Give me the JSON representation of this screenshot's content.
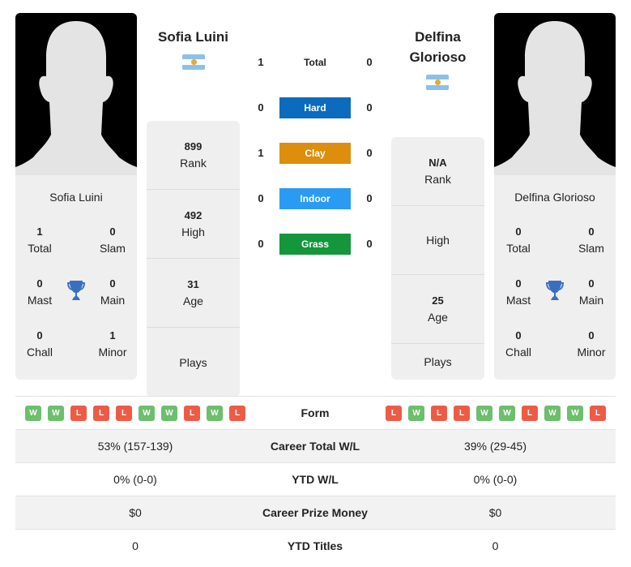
{
  "colors": {
    "hard": "#0a6bbf",
    "clay": "#dc8e0c",
    "indoor": "#2a9bf2",
    "grass": "#13973a",
    "win": "#6cbf6c",
    "loss": "#ee5b45",
    "trophy": "#3a6fbf"
  },
  "player1": {
    "name": "Sofia Luini",
    "card_name": "Sofia Luini",
    "flag": "argentina-flag",
    "rank": {
      "value": "899",
      "label": "Rank"
    },
    "high": {
      "value": "492",
      "label": "High"
    },
    "age": {
      "value": "31",
      "label": "Age"
    },
    "plays": {
      "value": "",
      "label": "Plays"
    },
    "titles": {
      "total": {
        "value": "1",
        "label": "Total"
      },
      "slam": {
        "value": "0",
        "label": "Slam"
      },
      "mast": {
        "value": "0",
        "label": "Mast"
      },
      "main": {
        "value": "0",
        "label": "Main"
      },
      "chall": {
        "value": "0",
        "label": "Chall"
      },
      "minor": {
        "value": "1",
        "label": "Minor"
      }
    },
    "form": [
      "W",
      "W",
      "L",
      "L",
      "L",
      "W",
      "W",
      "L",
      "W",
      "L"
    ]
  },
  "player2": {
    "name_line1": "Delfina",
    "name_line2": "Glorioso",
    "card_name": "Delfina Glorioso",
    "flag": "argentina-flag",
    "rank": {
      "value": "N/A",
      "label": "Rank"
    },
    "high": {
      "value": "",
      "label": "High"
    },
    "age": {
      "value": "25",
      "label": "Age"
    },
    "plays": {
      "value": "",
      "label": "Plays"
    },
    "titles": {
      "total": {
        "value": "0",
        "label": "Total"
      },
      "slam": {
        "value": "0",
        "label": "Slam"
      },
      "mast": {
        "value": "0",
        "label": "Mast"
      },
      "main": {
        "value": "0",
        "label": "Main"
      },
      "chall": {
        "value": "0",
        "label": "Chall"
      },
      "minor": {
        "value": "0",
        "label": "Minor"
      }
    },
    "form": [
      "L",
      "W",
      "L",
      "L",
      "W",
      "W",
      "L",
      "W",
      "W",
      "L"
    ]
  },
  "h2h": {
    "total": {
      "label": "Total",
      "p1": "1",
      "p2": "0"
    },
    "hard": {
      "label": "Hard",
      "p1": "0",
      "p2": "0"
    },
    "clay": {
      "label": "Clay",
      "p1": "1",
      "p2": "0"
    },
    "indoor": {
      "label": "Indoor",
      "p1": "0",
      "p2": "0"
    },
    "grass": {
      "label": "Grass",
      "p1": "0",
      "p2": "0"
    }
  },
  "table": {
    "form_label": "Form",
    "rows": [
      {
        "label": "Career Total W/L",
        "p1": "53% (157-139)",
        "p2": "39% (29-45)"
      },
      {
        "label": "YTD W/L",
        "p1": "0% (0-0)",
        "p2": "0% (0-0)"
      },
      {
        "label": "Career Prize Money",
        "p1": "$0",
        "p2": "$0"
      },
      {
        "label": "YTD Titles",
        "p1": "0",
        "p2": "0"
      }
    ]
  }
}
